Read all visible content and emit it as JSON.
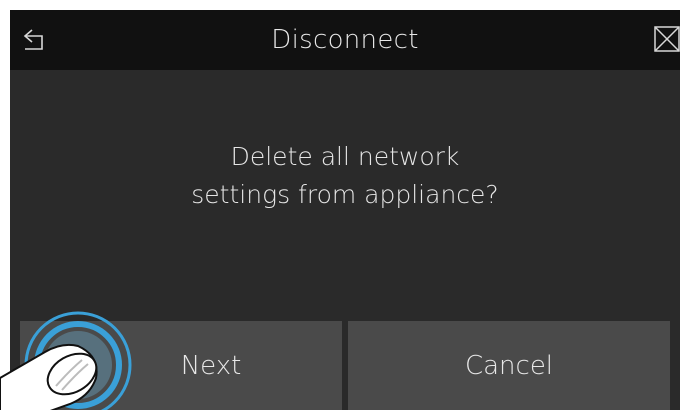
{
  "header": {
    "title": "Disconnect",
    "back_icon": "back-arrow-icon",
    "close_icon": "close-box-icon"
  },
  "dialog": {
    "message_line1": "Delete all network",
    "message_line2": "settings from appliance?"
  },
  "buttons": {
    "next_label": "Next",
    "cancel_label": "Cancel"
  },
  "colors": {
    "screen_bg": "#2a2a2a",
    "header_bg": "#111111",
    "button_bg": "#4a4a4a",
    "text": "#e8e8e8",
    "touch_ring": "#3aa0d8"
  }
}
